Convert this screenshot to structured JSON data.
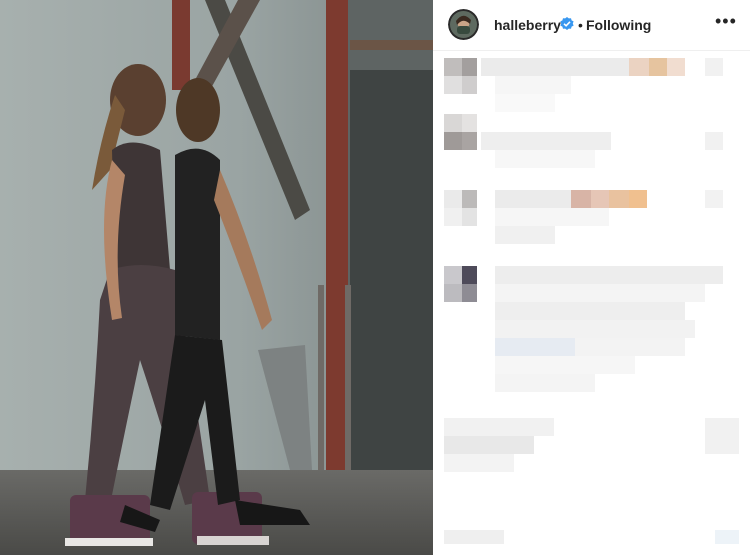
{
  "post": {
    "author": {
      "username": "halleberry",
      "verified": true,
      "follow_status": "Following"
    },
    "more_icon": "more-horizontal-icon"
  },
  "colors": {
    "text": "#262626",
    "verified_blue": "#3897f0",
    "border": "#efefef"
  }
}
